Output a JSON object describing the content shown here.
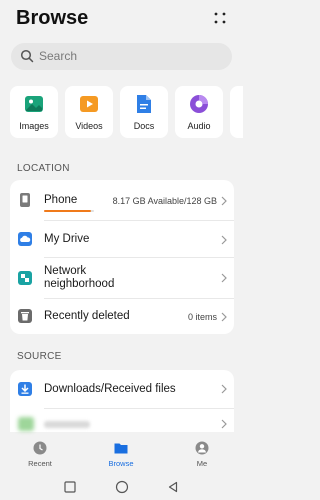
{
  "header": {
    "title": "Browse"
  },
  "search": {
    "placeholder": "Search"
  },
  "categories": [
    {
      "label": "Images",
      "icon": "images-icon",
      "color": "#1aa37a"
    },
    {
      "label": "Videos",
      "icon": "videos-icon",
      "color": "#f59a23"
    },
    {
      "label": "Docs",
      "icon": "docs-icon",
      "color": "#2f7fe6"
    },
    {
      "label": "Audio",
      "icon": "audio-icon",
      "color": "#8b4fd8"
    }
  ],
  "location": {
    "section_label": "LOCATION",
    "items": [
      {
        "name": "Phone",
        "value": "8.17 GB Available/128 GB",
        "icon": "phone-icon",
        "usage_fraction": 0.94
      },
      {
        "name": "My Drive",
        "value": "",
        "icon": "cloud-drive-icon"
      },
      {
        "name": "Network neighborhood",
        "value": "",
        "icon": "network-icon"
      },
      {
        "name": "Recently deleted",
        "value": "0 items",
        "icon": "trash-icon"
      }
    ]
  },
  "source": {
    "section_label": "SOURCE",
    "items": [
      {
        "name": "Downloads/Received files",
        "icon": "download-icon"
      }
    ]
  },
  "bottom_nav": [
    {
      "label": "Recent",
      "icon": "clock-icon",
      "active": false
    },
    {
      "label": "Browse",
      "icon": "folder-icon",
      "active": true
    },
    {
      "label": "Me",
      "icon": "person-icon",
      "active": false
    }
  ],
  "colors": {
    "accent": "#1a6fe0",
    "usage_bar": "#f07a1a",
    "background": "#f2f2f2"
  }
}
